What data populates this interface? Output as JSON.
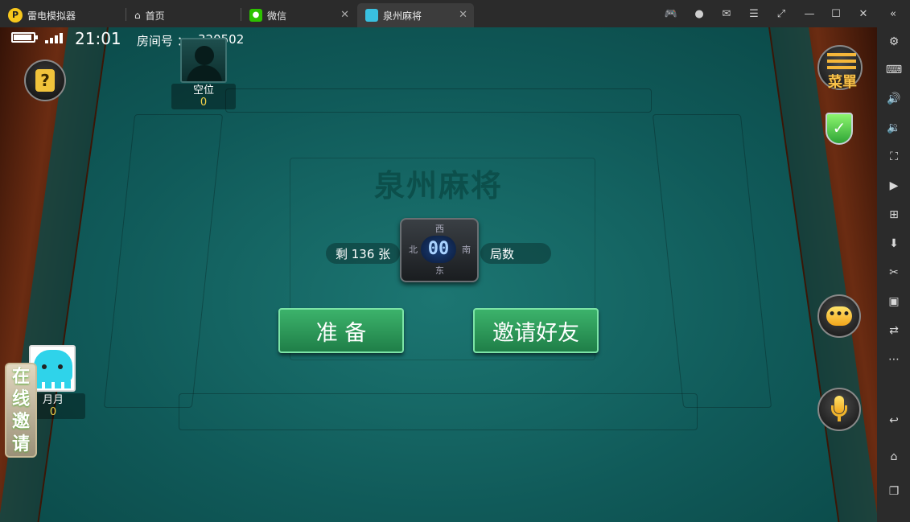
{
  "titlebar": {
    "app_name": "雷电模拟器",
    "tabs": [
      {
        "label": "首页"
      },
      {
        "label": "微信"
      },
      {
        "label": "泉州麻将"
      }
    ]
  },
  "status": {
    "time": "21:01",
    "room_label": "房间号 ：",
    "room_number": "320502"
  },
  "game": {
    "table_title": "泉州麻将",
    "top_seat": {
      "name": "空位",
      "score": "0"
    },
    "self_seat": {
      "name": "月月",
      "score": "0"
    },
    "center": {
      "counter": "00",
      "wind_top": "西",
      "wind_bottom": "东",
      "wind_left": "北",
      "wind_right": "南"
    },
    "remaining_tiles": "剩 136 张",
    "rounds_label": "局数",
    "ready_button": "准 备",
    "invite_button": "邀请好友",
    "menu_label": "菜單",
    "online_invite": [
      "在",
      "线",
      "邀",
      "请"
    ]
  },
  "colors": {
    "felt": "#105a59",
    "button_green": "#2e9b5a",
    "score_yellow": "#f3d34a"
  }
}
